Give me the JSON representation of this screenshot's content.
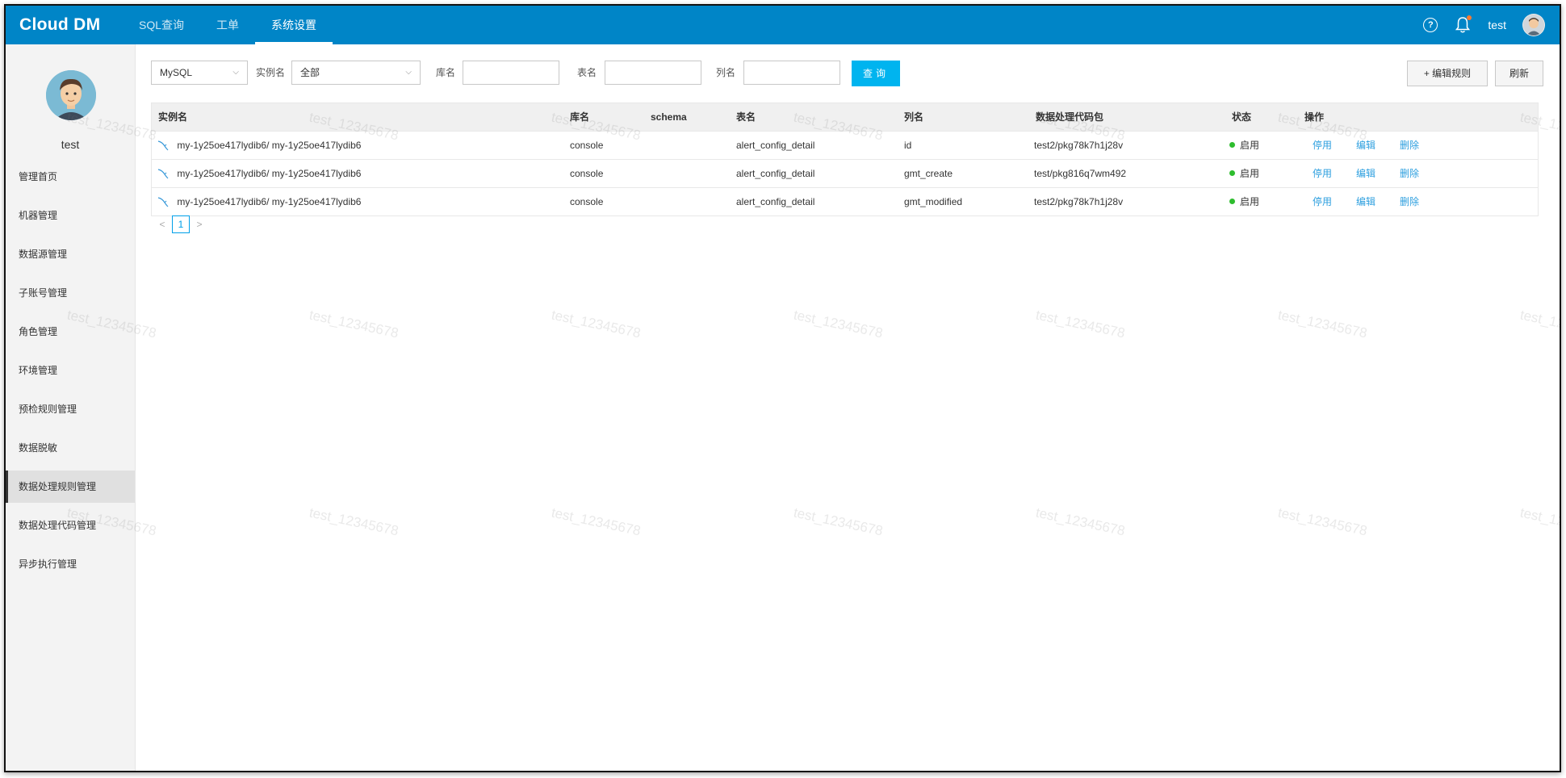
{
  "app": {
    "logo": "Cloud DM"
  },
  "nav": {
    "items": [
      "SQL查询",
      "工单",
      "系统设置"
    ],
    "active_index": 2
  },
  "topbar": {
    "username": "test"
  },
  "sidebar": {
    "username": "test",
    "items": [
      "管理首页",
      "机器管理",
      "数据源管理",
      "子账号管理",
      "角色管理",
      "环境管理",
      "预检规则管理",
      "数据脱敏",
      "数据处理规则管理",
      "数据处理代码管理",
      "异步执行管理"
    ],
    "active_index": 8
  },
  "filters": {
    "db_type": "MySQL",
    "instance_label": "实例名",
    "instance_value": "全部",
    "db_label": "库名",
    "table_label": "表名",
    "column_label": "列名",
    "query_button": "查询",
    "edit_rules_button": "+ 编辑规则",
    "refresh_button": "刷新"
  },
  "table": {
    "headers": [
      "实例名",
      "库名",
      "schema",
      "表名",
      "列名",
      "数据处理代码包",
      "状态",
      "操作"
    ],
    "rows": [
      {
        "instance": "my-1y25oe417lydib6/ my-1y25oe417lydib6",
        "db": "console",
        "schema": "",
        "table": "alert_config_detail",
        "column": "id",
        "package": "test2/pkg78k7h1j28v",
        "status": "启用",
        "op_disable": "停用",
        "op_edit": "编辑",
        "op_delete": "删除"
      },
      {
        "instance": "my-1y25oe417lydib6/ my-1y25oe417lydib6",
        "db": "console",
        "schema": "",
        "table": "alert_config_detail",
        "column": "gmt_create",
        "package": "test/pkg816q7wm492",
        "status": "启用",
        "op_disable": "停用",
        "op_edit": "编辑",
        "op_delete": "删除"
      },
      {
        "instance": "my-1y25oe417lydib6/ my-1y25oe417lydib6",
        "db": "console",
        "schema": "",
        "table": "alert_config_detail",
        "column": "gmt_modified",
        "package": "test2/pkg78k7h1j28v",
        "status": "启用",
        "op_disable": "停用",
        "op_edit": "编辑",
        "op_delete": "删除"
      }
    ]
  },
  "pagination": {
    "current": "1",
    "prev": "<",
    "next": ">"
  },
  "watermark": "test_12345678",
  "colors": {
    "topbar": "#0085c7",
    "accent": "#00b4ef",
    "link": "#2d9fdf",
    "status_on": "#2ebd2e"
  }
}
